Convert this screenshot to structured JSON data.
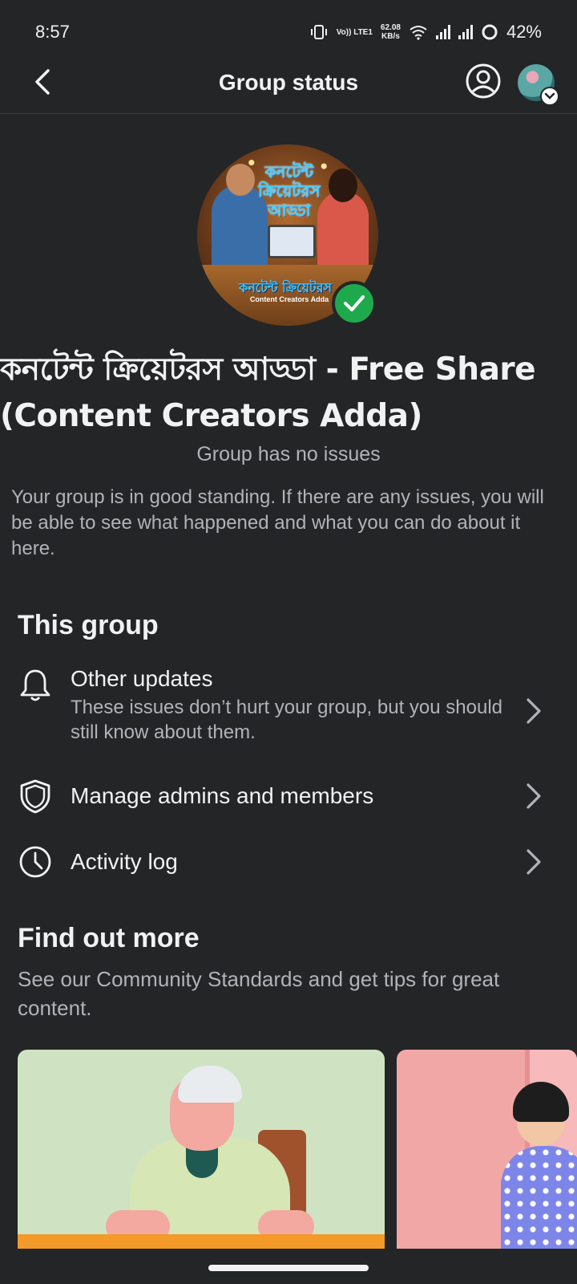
{
  "status_bar": {
    "time": "8:57",
    "volte": "Vo)) LTE1",
    "speed_value": "62.08",
    "speed_unit": "KB/s",
    "battery": "42%"
  },
  "header": {
    "title": "Group status",
    "back_icon": "chevron-left-icon",
    "profile_icon": "user-circle-icon"
  },
  "group": {
    "image_title": "কনটেন্ট ক্রিয়েটরস আড্ডা",
    "image_banner": "কনটেন্ট ক্রিয়েটরস",
    "image_subtitle": "Content Creators Adda",
    "name": "কনটেন্ট ক্রিয়েটরস আড্ডা - Free Share (Content Creators Adda)",
    "status": "Group has no issues",
    "description": "Your group is in good standing. If there are any issues, you will be able to see what happened and what you can do about it here."
  },
  "this_group": {
    "title": "This group",
    "items": [
      {
        "icon": "bell-icon",
        "label": "Other updates",
        "sub": "These issues don’t hurt your group, but you should still know about them."
      },
      {
        "icon": "shield-icon",
        "label": "Manage admins and members"
      },
      {
        "icon": "clock-icon",
        "label": "Activity log"
      }
    ]
  },
  "find_out_more": {
    "title": "Find out more",
    "description": "See our Community Standards and get tips for great content."
  },
  "colors": {
    "background": "#242527",
    "verified": "#1fa94d",
    "text_primary": "#f2f2f2",
    "text_secondary": "#b0b3b8"
  }
}
